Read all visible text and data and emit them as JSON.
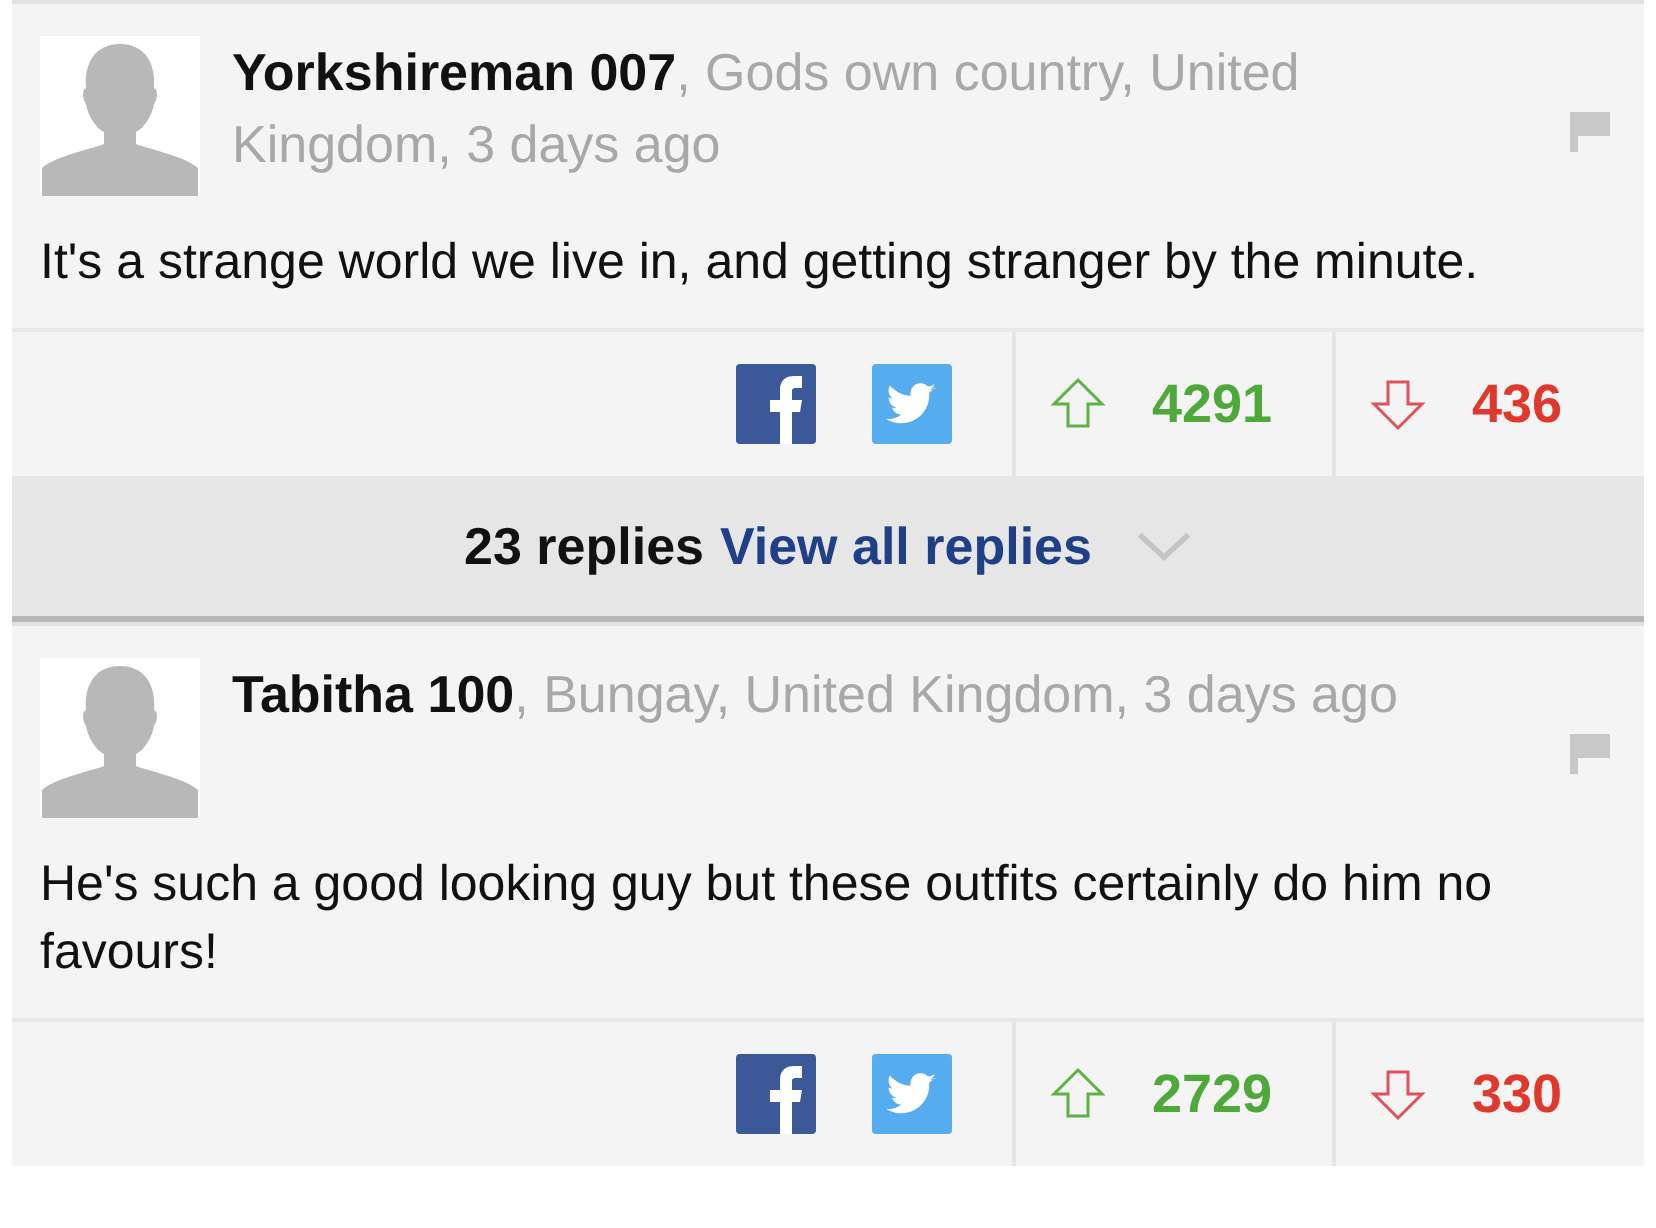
{
  "comments": [
    {
      "author": "Yorkshireman 007",
      "meta": ", Gods own country, United Kingdom, 3 days ago",
      "body": "It's a strange world we live in, and getting stranger by the minute.",
      "up": "4291",
      "down": "436",
      "replies": {
        "count": "23 replies",
        "link": "View all replies"
      }
    },
    {
      "author": "Tabitha 100",
      "meta": ", Bungay, United Kingdom, 3 days ago",
      "body": "He's such a good looking guy but these outfits certainly do him no favours!",
      "up": "2729",
      "down": "330"
    }
  ]
}
